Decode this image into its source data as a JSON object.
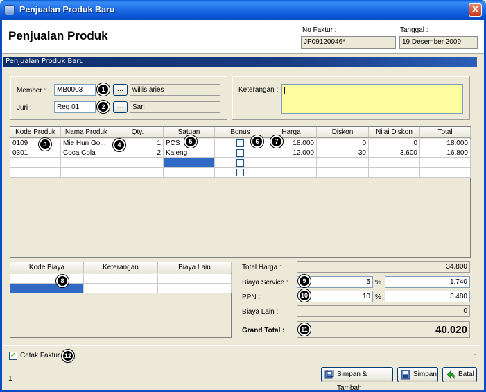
{
  "window": {
    "title": "Penjualan Produk Baru",
    "close_glyph": "X"
  },
  "header": {
    "title": "Penjualan Produk",
    "no_faktur_label": "No Faktur :",
    "no_faktur_value": "JP09120046*",
    "tanggal_label": "Tanggal :",
    "tanggal_value": "19 Desember 2009"
  },
  "section_title": "Penjualan Produk Baru",
  "form": {
    "member_label": "Member :",
    "member_code": "MB0003",
    "member_name": "willis aries",
    "juri_label": "Juri :",
    "juri_code": "Reg 01",
    "juri_name": "Sari",
    "browse_label": "...",
    "keterangan_label": "Keterangan :"
  },
  "badges": [
    "1",
    "2",
    "3",
    "4",
    "5",
    "6",
    "7",
    "8",
    "9",
    "10",
    "11",
    "12"
  ],
  "products": {
    "columns": [
      "Kode Produk",
      "Nama Produk",
      "Qty.",
      "Satuan",
      "Bonus",
      "Harga",
      "Diskon",
      "Nilai Diskon",
      "Total"
    ],
    "rows": [
      {
        "kode": "0109",
        "nama": "Mie Hun Go...",
        "qty": "1",
        "satuan": "PCS",
        "harga": "18.000",
        "diskon": "0",
        "nilai_diskon": "0",
        "total": "18.000"
      },
      {
        "kode": "0301",
        "nama": "Coca Cola",
        "qty": "2",
        "satuan": "Kaleng",
        "harga": "12.000",
        "diskon": "30",
        "nilai_diskon": "3.600",
        "total": "16.800"
      }
    ]
  },
  "biaya": {
    "columns": [
      "Kode Biaya",
      "Keterangan",
      "Biaya Lain"
    ]
  },
  "summary": {
    "total_harga_label": "Total Harga :",
    "total_harga": "34.800",
    "biaya_service_label": "Biaya Service :",
    "biaya_service_pct": "5",
    "biaya_service_value": "1.740",
    "ppn_label": "PPN :",
    "ppn_pct": "10",
    "ppn_value": "3.480",
    "pct_sign": "%",
    "biaya_lain_label": "Biaya Lain :",
    "biaya_lain": "0",
    "grand_total_label": "Grand Total :",
    "grand_total": "40.020"
  },
  "footer": {
    "cetak_faktur_label": "Cetak Faktur",
    "cetak_faktur_checked": true,
    "dash": "-",
    "status_number": "1",
    "btn_simpan_tambah": "Simpan & Tambah",
    "btn_simpan": "Simpan",
    "btn_batal": "Batal"
  }
}
